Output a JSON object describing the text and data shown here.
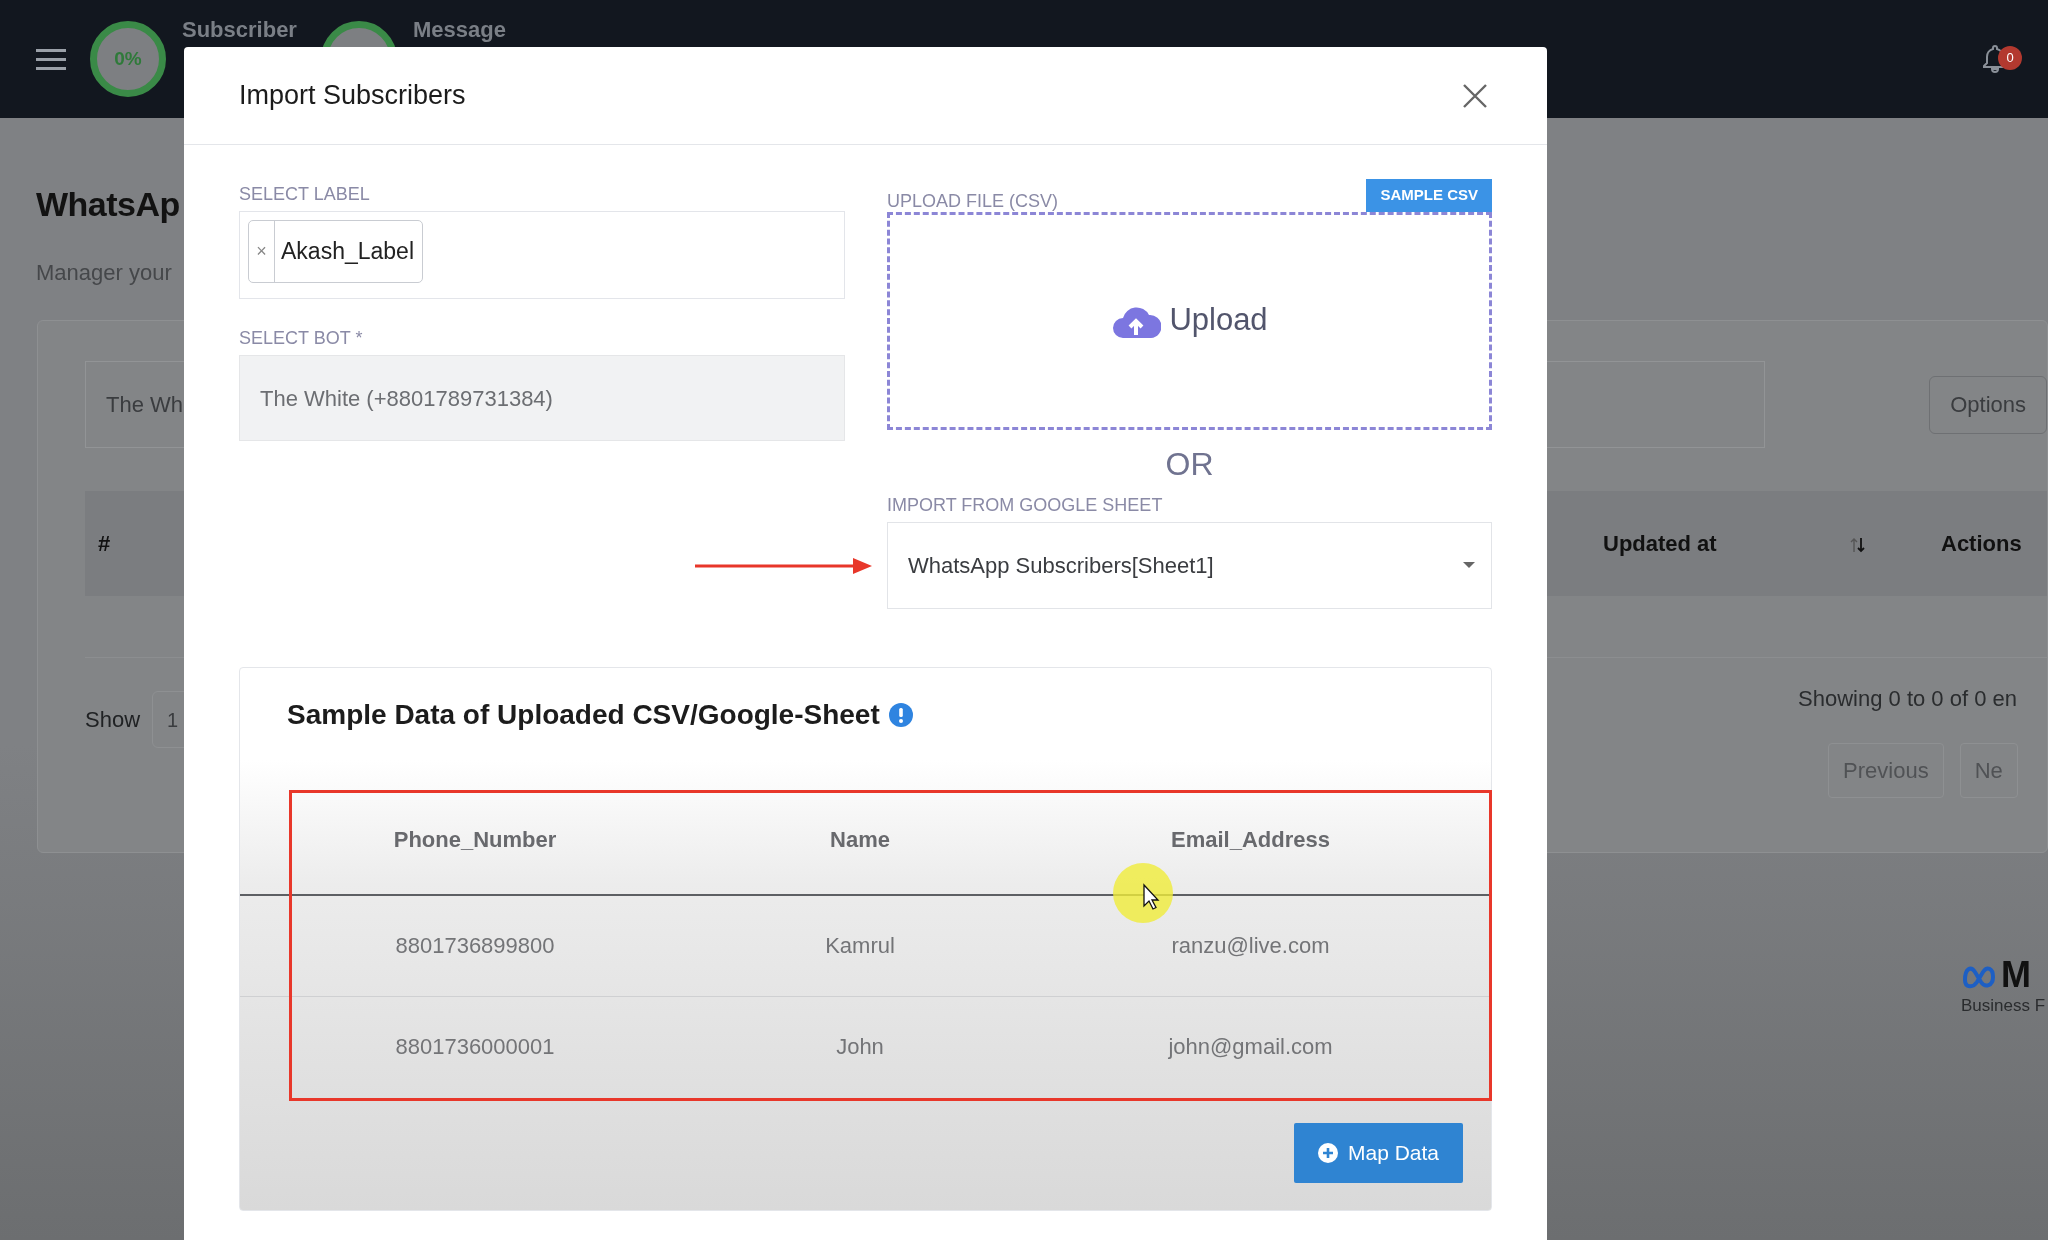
{
  "topbar": {
    "progress_label": "0%",
    "menu_items": [
      "Subscriber",
      "Message"
    ],
    "notification_count": "0"
  },
  "page": {
    "title": "WhatsAp",
    "subtitle": "Manager your",
    "bot_field": "The Wh",
    "options_button": "Options",
    "columns": [
      "#",
      "Updated at",
      "Actions"
    ],
    "show_label": "Show",
    "page_size": "1",
    "info": "Showing 0 to 0 of 0 en",
    "pagination": [
      "Previous",
      "Ne"
    ],
    "brand": {
      "logo": "M",
      "caption": "Business F"
    }
  },
  "modal": {
    "title": "Import Subscribers",
    "label_field": {
      "label": "SELECT LABEL",
      "tags": [
        {
          "text": "Akash_Label",
          "remove": "×"
        }
      ]
    },
    "bot_field": {
      "label": "SELECT BOT *",
      "value": "The White (+8801789731384)"
    },
    "upload": {
      "label": "UPLOAD FILE (CSV)",
      "sample_button": "SAMPLE CSV",
      "button": "Upload"
    },
    "separator": "OR",
    "sheet_field": {
      "label": "IMPORT FROM GOOGLE SHEET",
      "value": "WhatsApp Subscribers[Sheet1]"
    },
    "sample": {
      "title": "Sample Data of Uploaded CSV/Google-Sheet",
      "columns": [
        "Phone_Number",
        "Name",
        "Email_Address"
      ],
      "rows": [
        [
          "8801736899800",
          "Kamrul",
          "ranzu@live.com"
        ],
        [
          "8801736000001",
          "John",
          "john@gmail.com"
        ]
      ]
    },
    "action_button": "Map Data"
  },
  "annotations": [
    {
      "kind": "arrow"
    },
    {
      "kind": "frame"
    },
    {
      "kind": "cursor"
    }
  ]
}
